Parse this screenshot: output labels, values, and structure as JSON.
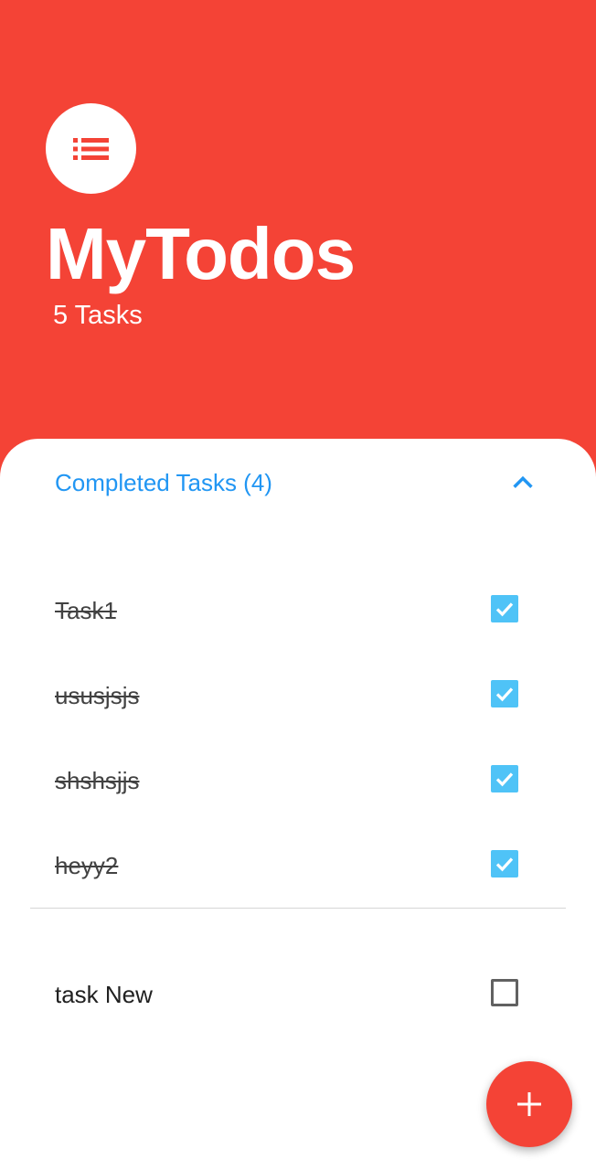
{
  "header": {
    "title": "MyTodos",
    "task_count": "5 Tasks",
    "icon": "list-icon"
  },
  "completed_section": {
    "title": "Completed Tasks (4)",
    "expanded": true,
    "toggle_icon": "chevron-up-icon"
  },
  "completed_tasks": [
    {
      "label": "Task1",
      "done": true
    },
    {
      "label": "ususjsjs",
      "done": true
    },
    {
      "label": "shshsjjs",
      "done": true
    },
    {
      "label": "heyy2",
      "done": true
    }
  ],
  "pending_tasks": [
    {
      "label": "task New",
      "done": false
    }
  ],
  "fab": {
    "icon": "plus-icon"
  },
  "colors": {
    "primary": "#f44336",
    "accent": "#2196f3",
    "checkbox_checked": "#4fc3f7"
  }
}
